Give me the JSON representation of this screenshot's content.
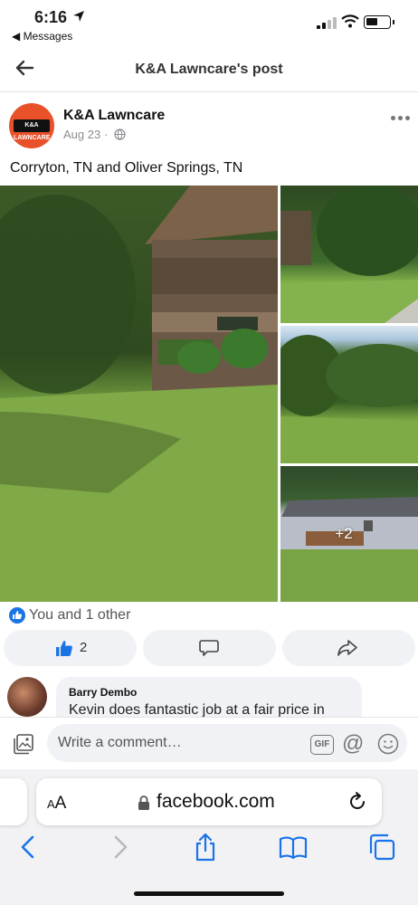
{
  "status_bar": {
    "time": "6:16",
    "back_app": "◀ Messages"
  },
  "header": {
    "title": "K&A Lawncare's post"
  },
  "post": {
    "page_name": "K&A Lawncare",
    "avatar_text": "K&A LAWNCARE",
    "date": "Aug 23",
    "separator": "·",
    "text": "Corryton, TN and Oliver Springs, TN",
    "more_photos": "+2"
  },
  "reactions": {
    "summary": "You and 1 other",
    "like_count": "2"
  },
  "comment": {
    "author": "Barry Dembo",
    "text": "Kevin does fantastic job at a fair price in"
  },
  "composer": {
    "placeholder": "Write a comment…",
    "gif_label": "GIF",
    "at_symbol": "@"
  },
  "browser": {
    "aa_small": "A",
    "aa_large": "A",
    "url": "facebook.com"
  },
  "colors": {
    "facebook_blue": "#1b74e4",
    "ios_blue": "#1a73e8",
    "bubble_gray": "#f0f2f5",
    "avatar_orange": "#e8512a"
  },
  "icons": {
    "location": "location-arrow-icon",
    "signal": "cellular-signal-icon",
    "wifi": "wifi-icon",
    "battery": "battery-icon",
    "back": "back-arrow-icon",
    "globe": "globe-icon",
    "more": "more-options-icon",
    "like": "thumbs-up-icon",
    "comment": "comment-icon",
    "share": "share-icon",
    "photo": "photo-icon",
    "gif": "gif-icon",
    "at": "mention-icon",
    "emoji": "emoji-icon",
    "lock": "lock-icon",
    "reload": "reload-icon",
    "nav_back": "chevron-left-icon",
    "nav_forward": "chevron-right-icon",
    "nav_share": "share-sheet-icon",
    "bookmarks": "bookmarks-icon",
    "tabs": "tabs-icon"
  }
}
